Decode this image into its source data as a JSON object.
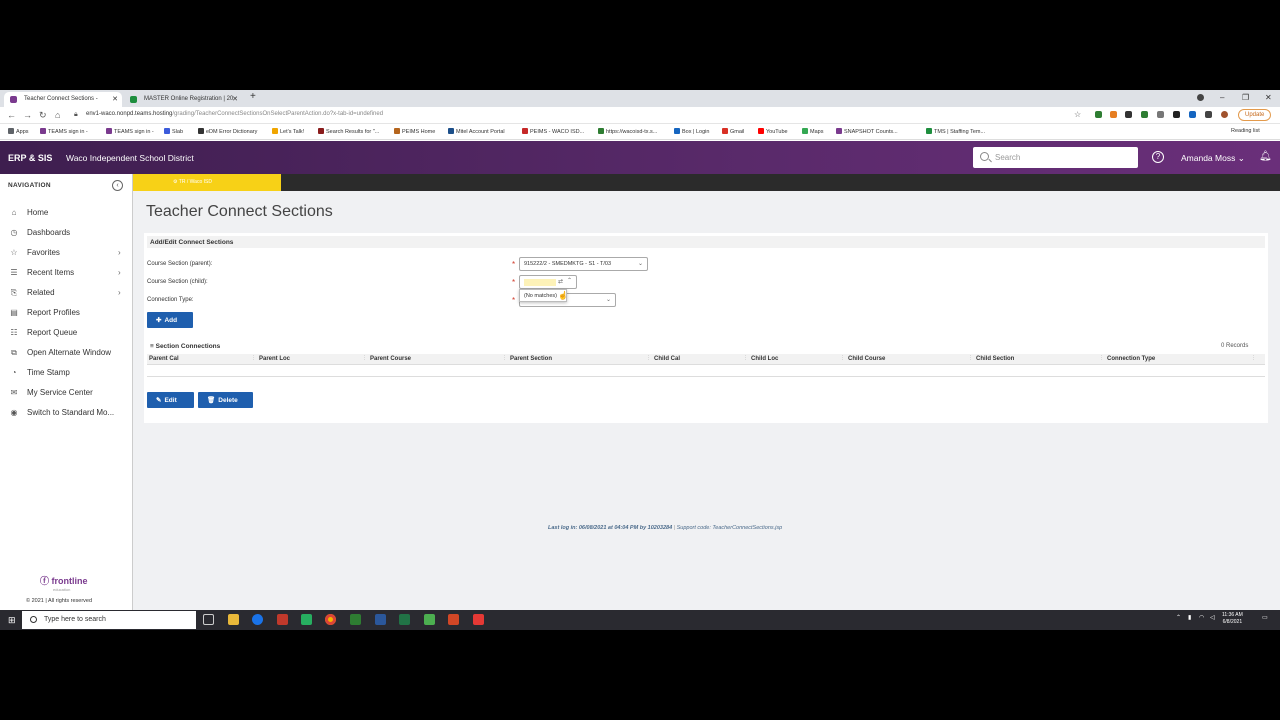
{
  "browser": {
    "tabs": [
      {
        "title": "Teacher Connect Sections -",
        "active": true,
        "color": "#7a3a8e"
      },
      {
        "title": "MASTER Online Registration | 20",
        "active": false,
        "color": "#1e8e3e"
      }
    ],
    "url_host": "env1-waco.nonpd.teams.hosting",
    "url_path": "/grading/TeacherConnectSectionsOnSelectParentAction.do?x-tab-id=undefined",
    "update_label": "Update",
    "bookmarks": [
      {
        "label": "Apps",
        "color": "#5f6368"
      },
      {
        "label": "TEAMS sign in -",
        "color": "#7a3a8e"
      },
      {
        "label": "TEAMS sign in -",
        "color": "#7a3a8e"
      },
      {
        "label": "Slab",
        "color": "#3b5bdb"
      },
      {
        "label": "eDM Error Dictionary",
        "color": "#333333"
      },
      {
        "label": "Let's Talk!",
        "color": "#f0a500"
      },
      {
        "label": "Search Results for \"...",
        "color": "#8a1c1c"
      },
      {
        "label": "PEIMS Home",
        "color": "#b5651d"
      },
      {
        "label": "Mitel Account Portal",
        "color": "#1c4f8a"
      },
      {
        "label": "PEIMS - WACO ISD...",
        "color": "#c62828"
      },
      {
        "label": "https://wacoisd-tx.s...",
        "color": "#2e7d32"
      },
      {
        "label": "Box | Login",
        "color": "#1565c0"
      },
      {
        "label": "Gmail",
        "color": "#d93025"
      },
      {
        "label": "YouTube",
        "color": "#ff0000"
      },
      {
        "label": "Maps",
        "color": "#34a853"
      },
      {
        "label": "SNAPSHOT Counts...",
        "color": "#7a3a8e"
      },
      {
        "label": "TMS | Staffing Tem...",
        "color": "#1e8e3e"
      }
    ],
    "reading_list": "Reading list"
  },
  "header": {
    "brand": "ERP & SIS",
    "district": "Waco Independent School District",
    "search_placeholder": "Search",
    "user": "Amanda Moss",
    "help_icon": "?"
  },
  "sidebar": {
    "title": "NAVIGATION",
    "items": [
      {
        "label": "Home",
        "icon": "⌂",
        "arrow": false
      },
      {
        "label": "Dashboards",
        "icon": "◷",
        "arrow": false
      },
      {
        "label": "Favorites",
        "icon": "☆",
        "arrow": true
      },
      {
        "label": "Recent Items",
        "icon": "☰",
        "arrow": true
      },
      {
        "label": "Related",
        "icon": "⎘",
        "arrow": true
      },
      {
        "label": "Report Profiles",
        "icon": "▤",
        "arrow": false
      },
      {
        "label": "Report Queue",
        "icon": "☷",
        "arrow": false
      },
      {
        "label": "Open Alternate Window",
        "icon": "⧉",
        "arrow": false
      },
      {
        "label": "Time Stamp",
        "icon": "◔",
        "arrow": false
      },
      {
        "label": "My Service Center",
        "icon": "✉",
        "arrow": false
      },
      {
        "label": "Switch to Standard Mo...",
        "icon": "◉",
        "arrow": false
      }
    ],
    "logo": "frontline",
    "logo_sub": "education",
    "copyright": "© 2021 | All rights reserved"
  },
  "context": {
    "tag": "TR / Waco ISD"
  },
  "page": {
    "title": "Teacher Connect Sections",
    "panel_title": "Add/Edit Connect Sections",
    "fields": {
      "parent_label": "Course Section (parent):",
      "parent_value": "915222/2 - SMEDMKTG - S1 - T/03",
      "child_label": "Course Section (child):",
      "child_value": "",
      "conn_label": "Connection Type:",
      "conn_value": ""
    },
    "dropdown_text": "(No matches)",
    "add_button": "Add",
    "section_title": "Section Connections",
    "records": "0 Records",
    "columns": [
      "Parent Cal",
      "Parent Loc",
      "Parent Course",
      "Parent Section",
      "Child Cal",
      "Child Loc",
      "Child Course",
      "Child Section",
      "Connection Type"
    ],
    "edit_button": "Edit",
    "delete_button": "Delete",
    "footer_last": "Last log in: 06/08/2021 at 04:04 PM by 10203284",
    "footer_support": "Support code: TeacherConnectSections.jsp"
  },
  "taskbar": {
    "search_placeholder": "Type here to search",
    "time": "11:36 AM",
    "date": "6/8/2021"
  },
  "colors": {
    "header_purple": "#5a2a6b",
    "accent_blue": "#1f5fae",
    "required_red": "#d03a2a",
    "context_yellow": "#f7d117"
  }
}
